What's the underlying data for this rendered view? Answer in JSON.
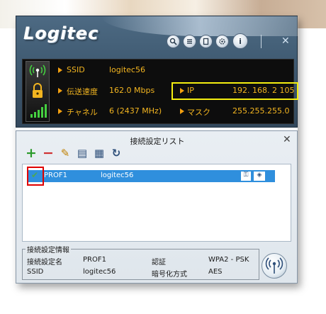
{
  "app": {
    "brand": "Logitec"
  },
  "status": {
    "ssid_label": "SSID",
    "ssid_value": "logitec56",
    "speed_label": "伝送速度",
    "speed_value": "162.0 Mbps",
    "channel_label": "チャネル",
    "channel_value": "6 (2437 MHz)",
    "ip_label": "IP",
    "ip_value": "192. 168.  2  105",
    "mask_label": "マスク",
    "mask_value": "255.255.255.0"
  },
  "list": {
    "title": "接続設定リスト",
    "toolbar": [
      {
        "name": "add",
        "glyph": "+",
        "color": "#2a9a2a"
      },
      {
        "name": "remove",
        "glyph": "−",
        "color": "#d03030"
      },
      {
        "name": "edit",
        "glyph": "✎",
        "color": "#c08000"
      },
      {
        "name": "export",
        "glyph": "▤",
        "color": "#2e4f7a"
      },
      {
        "name": "import",
        "glyph": "▦",
        "color": "#2e4f7a"
      },
      {
        "name": "refresh",
        "glyph": "↻",
        "color": "#2e4f7a"
      }
    ],
    "rows": [
      {
        "profile": "PROF1",
        "ssid": "logitec56",
        "selected": true
      }
    ]
  },
  "info": {
    "legend": "接続設定情報",
    "name_label": "接続設定名",
    "name_value": "PROF1",
    "auth_label": "認証",
    "auth_value": "WPA2 - PSK",
    "ssid_label": "SSID",
    "ssid_value": "logitec56",
    "enc_label": "暗号化方式",
    "enc_value": "AES"
  },
  "icons": {
    "toolbar_top": [
      "search-icon",
      "list-icon",
      "document-icon",
      "settings-icon",
      "info-icon"
    ]
  },
  "colors": {
    "accent_amber": "#f3b520",
    "highlight_yellow": "#f4ee10",
    "selection_blue": "#2f8fdd",
    "annotation_red": "#e00000"
  }
}
